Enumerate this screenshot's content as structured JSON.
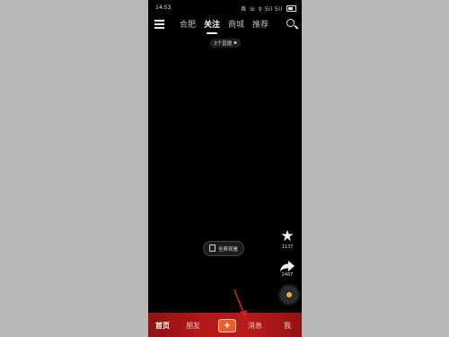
{
  "status_bar": {
    "time": "14:53",
    "icons_text": "奂 ☏ ⚲ 5il 5il"
  },
  "top_nav": {
    "tabs": [
      {
        "label": "合肥",
        "active": false
      },
      {
        "label": "关注",
        "active": true
      },
      {
        "label": "商城",
        "active": false
      },
      {
        "label": "推荐",
        "active": false
      }
    ]
  },
  "live_badge": {
    "text": "3个直播"
  },
  "fullscreen": {
    "label": "全屏观看"
  },
  "side_actions": {
    "favorite_count": "1137",
    "share_count": "2467"
  },
  "bottom_nav": {
    "home": "首页",
    "friends": "朋友",
    "plus": "+",
    "messages": "消息",
    "me": "我"
  },
  "colors": {
    "accent_red": "#b31818",
    "plus_orange": "#f05b2a",
    "arrow": "#d32020"
  }
}
